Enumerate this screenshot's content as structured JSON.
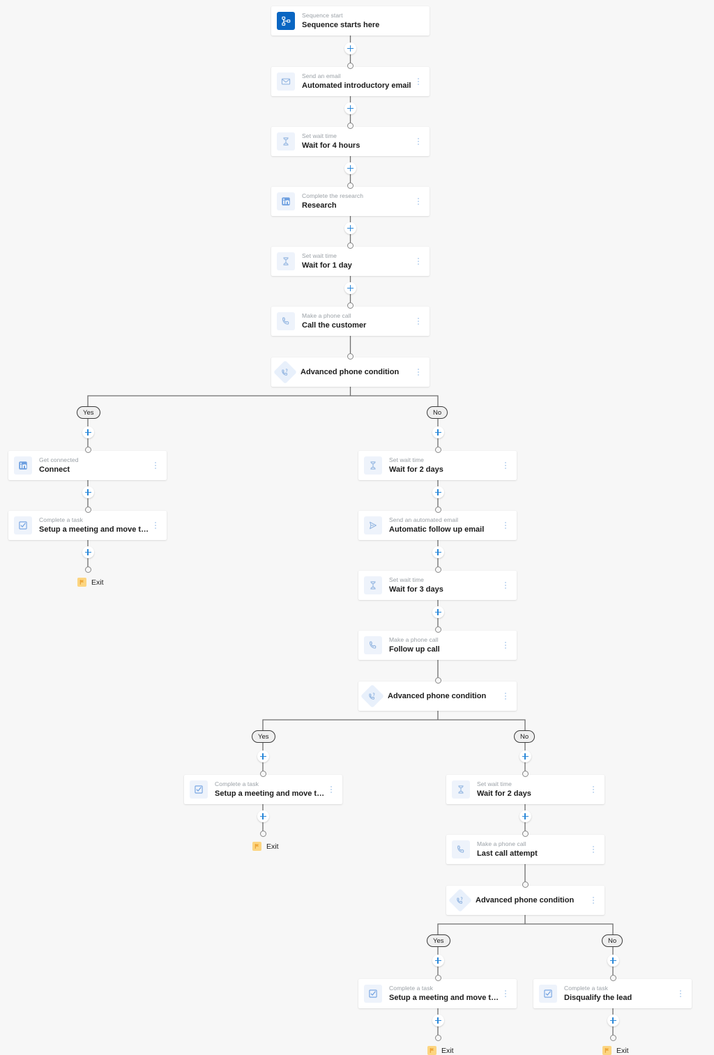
{
  "canvas": {
    "background": "#f7f7f7",
    "accent": "#2b88d8",
    "brand_linkedin": "#0a66c2",
    "flag_color": "#fcd581"
  },
  "labels": {
    "yes": "Yes",
    "no": "No",
    "exit": "Exit",
    "add_step_tooltip": "+",
    "more_options": "More options"
  },
  "nodes": {
    "n1": {
      "sub": "Sequence start",
      "title": "Sequence starts here",
      "icon": "sitemap-icon"
    },
    "n2": {
      "sub": "Send an email",
      "title": "Automated introductory email",
      "icon": "envelope-icon"
    },
    "n3": {
      "sub": "Set wait time",
      "title": "Wait for 4 hours",
      "icon": "hourglass-icon"
    },
    "n4": {
      "sub": "Complete the research",
      "title": "Research",
      "icon": "linkedin-icon"
    },
    "n5": {
      "sub": "Set wait time",
      "title": "Wait for 1 day",
      "icon": "hourglass-icon"
    },
    "n6": {
      "sub": "Make a phone call",
      "title": "Call the customer",
      "icon": "phone-icon"
    },
    "c1": {
      "sub": "",
      "title": "Advanced phone condition",
      "icon": "phone-condition-icon"
    },
    "y1a": {
      "sub": "Get connected",
      "title": "Connect",
      "icon": "linkedin-icon"
    },
    "y1b": {
      "sub": "Complete a task",
      "title": "Setup a meeting and move to the next s...",
      "icon": "checkbox-icon"
    },
    "n1a": {
      "sub": "Set wait time",
      "title": "Wait for 2 days",
      "icon": "hourglass-icon"
    },
    "n1b": {
      "sub": "Send an automated email",
      "title": "Automatic follow up email",
      "icon": "paper-plane-icon"
    },
    "n1c": {
      "sub": "Set wait time",
      "title": "Wait for 3 days",
      "icon": "hourglass-icon"
    },
    "n1d": {
      "sub": "Make a phone call",
      "title": "Follow up call",
      "icon": "phone-icon"
    },
    "c2": {
      "sub": "",
      "title": "Advanced phone condition",
      "icon": "phone-condition-icon"
    },
    "y2a": {
      "sub": "Complete a task",
      "title": "Setup a meeting and move to the next s...",
      "icon": "checkbox-icon"
    },
    "n2a": {
      "sub": "Set wait time",
      "title": "Wait for 2 days",
      "icon": "hourglass-icon"
    },
    "n2b": {
      "sub": "Make a phone call",
      "title": "Last call attempt",
      "icon": "phone-icon"
    },
    "c3": {
      "sub": "",
      "title": "Advanced phone condition",
      "icon": "phone-condition-icon"
    },
    "y3a": {
      "sub": "Complete a task",
      "title": "Setup a meeting and move to the next s...",
      "icon": "checkbox-icon"
    },
    "n3a": {
      "sub": "Complete a task",
      "title": "Disqualify the lead",
      "icon": "checkbox-icon"
    }
  }
}
